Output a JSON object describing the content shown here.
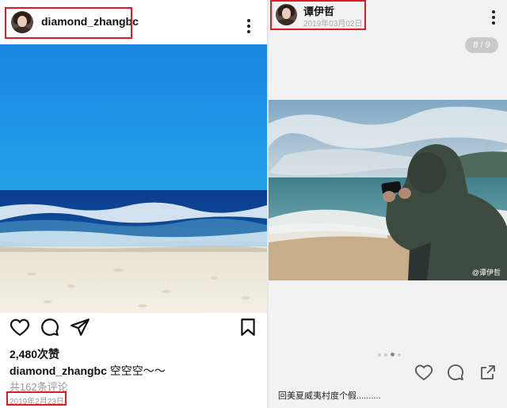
{
  "left_post": {
    "username": "diamond_zhangbc",
    "likes": "2,480次赞",
    "caption_user": "diamond_zhangbc",
    "caption_text": "空空空～～",
    "comments": "共162条评论",
    "date": "2019年2月23日",
    "icons": [
      "heart-icon",
      "comment-icon",
      "share-icon",
      "bookmark-icon",
      "more-icon"
    ]
  },
  "right_post": {
    "username": "谭伊哲",
    "date": "2019年03月02日",
    "image_counter": "8 / 9",
    "watermark": "@谭伊哲",
    "caption": "回美夏威夷村度个假..........",
    "carousel": {
      "total": 4,
      "active": 3
    },
    "icons": [
      "heart-icon",
      "comment-icon",
      "share-icon",
      "more-icon"
    ]
  },
  "colors": {
    "highlight_box": "#e01b24",
    "muted_text": "#999999",
    "right_bg": "#f2f2f2"
  }
}
